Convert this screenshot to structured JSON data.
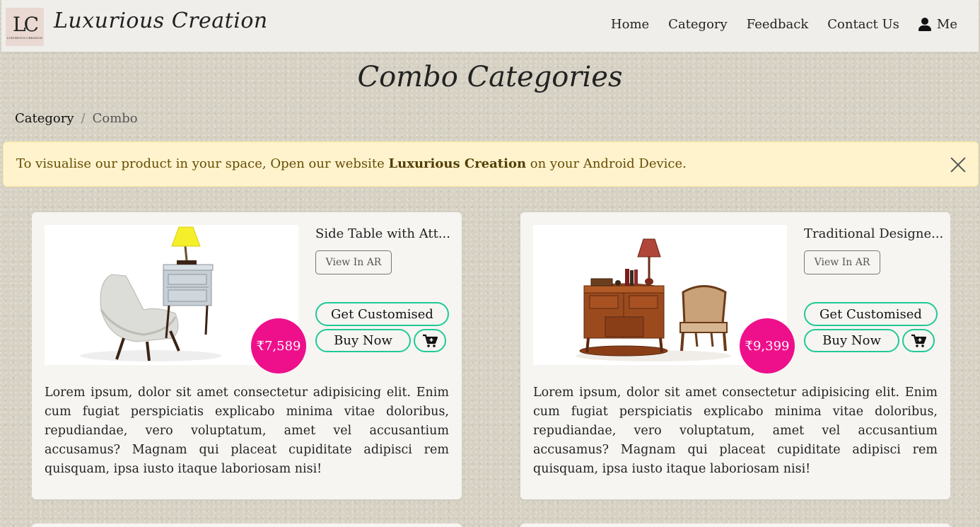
{
  "navbar": {
    "logo_letters": "LC",
    "logo_sub": "LUXURIOUS CREATION",
    "brand": "Luxurious Creation",
    "links": [
      "Home",
      "Category",
      "Feedback",
      "Contact Us"
    ],
    "user_label": "Me"
  },
  "page": {
    "title": "Combo Categories",
    "breadcrumb": {
      "parent": "Category",
      "separator": "/",
      "current": "Combo"
    }
  },
  "alert": {
    "text_before": "To visualise our product in your space, Open our website ",
    "brand": "Luxurious Creation",
    "text_after": " on your Android Device."
  },
  "products": [
    {
      "title": "Side Table with Att...",
      "price": "₹7,589",
      "ar_label": "View In AR",
      "customise_label": "Get Customised",
      "buy_label": "Buy Now",
      "description": "Lorem ipsum, dolor sit amet consectetur adipisicing elit. Enim cum fugiat perspiciatis explicabo minima vitae doloribus, repudiandae, vero voluptatum, amet vel accusantium accusamus? Magnam qui placeat cupiditate adipisci rem quisquam, ipsa iusto itaque laboriosam nisi!"
    },
    {
      "title": "Traditional Designe...",
      "price": "₹9,399",
      "ar_label": "View In AR",
      "customise_label": "Get Customised",
      "buy_label": "Buy Now",
      "description": "Lorem ipsum, dolor sit amet consectetur adipisicing elit. Enim cum fugiat perspiciatis explicabo minima vitae doloribus, repudiandae, vero voluptatum, amet vel accusantium accusamus? Magnam qui placeat cupiditate adipisci rem quisquam, ipsa iusto itaque laboriosam nisi!"
    }
  ],
  "colors": {
    "price_badge": "#ee0f8b",
    "button_border": "#20c997",
    "alert_bg": "#fff3cd",
    "alert_text": "#664d03"
  },
  "icons": [
    "user-icon",
    "close-icon",
    "cart-icon"
  ]
}
